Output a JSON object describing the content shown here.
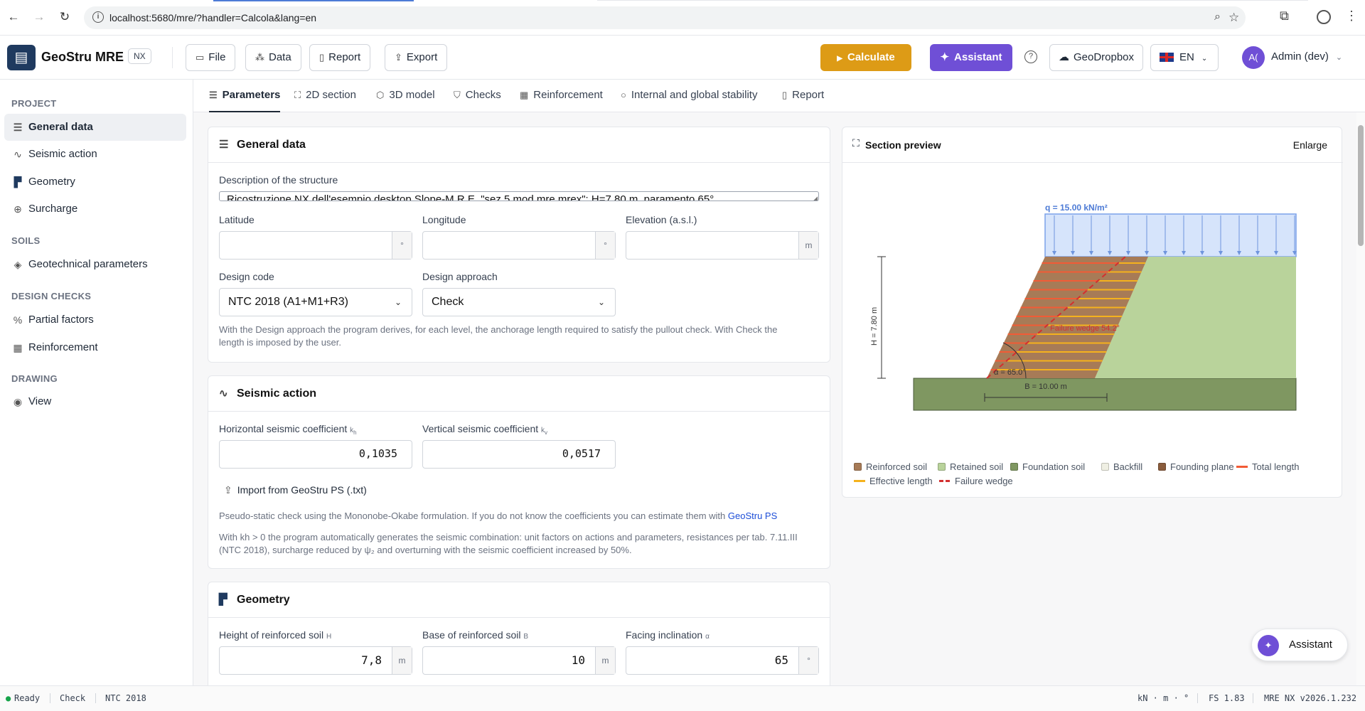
{
  "browser": {
    "url": "localhost:5680/mre/?handler=Calcola&lang=en"
  },
  "app": {
    "name": "GeoStru MRE",
    "badge": "NX",
    "menu": [
      "File",
      "Data",
      "Report",
      "Export"
    ],
    "calculate_label": "Calculate",
    "assistant_label": "Assistant",
    "help_label": "?",
    "geodropbox_label": "GeoDropbox",
    "language": "EN",
    "user_initials": "A(",
    "user_name": "Admin (dev)"
  },
  "sidebar": {
    "sections": [
      {
        "title": "PROJECT",
        "items": [
          {
            "label": "General data",
            "icon": "sliders-icon",
            "active": true
          },
          {
            "label": "Seismic action",
            "icon": "activity-icon"
          },
          {
            "label": "Geometry",
            "icon": "ruler-icon"
          },
          {
            "label": "Surcharge",
            "icon": "download-circle-icon"
          }
        ]
      },
      {
        "title": "SOILS",
        "items": [
          {
            "label": "Geotechnical parameters",
            "icon": "layers-icon"
          }
        ]
      },
      {
        "title": "DESIGN CHECKS",
        "items": [
          {
            "label": "Partial factors",
            "icon": "percent-icon"
          },
          {
            "label": "Reinforcement",
            "icon": "grid-icon"
          }
        ]
      },
      {
        "title": "DRAWING",
        "items": [
          {
            "label": "View",
            "icon": "eye-icon"
          }
        ]
      }
    ]
  },
  "tabs": [
    {
      "label": "Parameters",
      "icon": "list-icon",
      "active": true
    },
    {
      "label": "2D section",
      "icon": "section-icon"
    },
    {
      "label": "3D model",
      "icon": "cube-icon"
    },
    {
      "label": "Checks",
      "icon": "shield-icon"
    },
    {
      "label": "Reinforcement",
      "icon": "table-icon"
    },
    {
      "label": "Internal and global stability",
      "icon": "circle-icon"
    },
    {
      "label": "Report",
      "icon": "file-icon"
    }
  ],
  "general": {
    "title": "General data",
    "description_label": "Description of the structure",
    "description_value": "Ricostruzione NX dell'esempio desktop Slope-M.R.E. \"sez 5 mod mre.mrex\": H=7.80 m, paramento 65°",
    "latitude_label": "Latitude",
    "latitude_unit": "°",
    "longitude_label": "Longitude",
    "longitude_unit": "°",
    "elevation_label": "Elevation (a.s.l.)",
    "elevation_unit": "m",
    "design_code_label": "Design code",
    "design_code_value": "NTC 2018 (A1+M1+R3)",
    "design_approach_label": "Design approach",
    "design_approach_value": "Check",
    "note_line1": "With the Design approach the program derives, for each level, the anchorage length required to satisfy the pullout check. With Check the",
    "note_line2": "length is imposed by the user."
  },
  "seismic": {
    "title": "Seismic action",
    "kh_label": "Horizontal seismic coefficient",
    "kh_sym": "k",
    "kh_sub": "h",
    "kh_value": "0,1035",
    "kv_label": "Vertical seismic coefficient",
    "kv_sym": "k",
    "kv_sub": "v",
    "kv_value": "0,0517",
    "import_label": "Import from GeoStru PS (.txt)",
    "note1_text": "Pseudo-static check using the Mononobe-Okabe formulation. If you do not know the coefficients you can estimate them with",
    "note1_link": "GeoStru PS",
    "note2_line1": "With kh > 0 the program automatically generates the seismic combination: unit factors on actions and parameters, resistances per tab. 7.11.III",
    "note2_line2": "(NTC 2018), surcharge reduced by ψ₂ and overturning with the seismic coefficient increased by 50%."
  },
  "geometry": {
    "title": "Geometry",
    "h_label": "Height of reinforced soil",
    "h_sym": "H",
    "h_value": "7,8",
    "h_unit": "m",
    "b_label": "Base of reinforced soil",
    "b_sym": "B",
    "b_value": "10",
    "b_unit": "m",
    "a_label": "Facing inclination",
    "a_sym": "α",
    "a_value": "65",
    "a_unit": "°"
  },
  "preview": {
    "title": "Section preview",
    "enlarge_label": "Enlarge",
    "surcharge_label": "q = 15.00 kN/m²",
    "height_label": "H = 7.80 m",
    "base_label": "B = 10.00 m",
    "angle_label": "α = 65.0°",
    "wedge_label": "Failure wedge 54.2°",
    "colors": {
      "reinforced": "#a77b57",
      "retained": "#b9d39b",
      "foundation": "#7f9761",
      "backfill": "#efefe3",
      "founding": "#8a5c3c",
      "total": "#f25b36",
      "effective": "#f5b21d",
      "wedge": "#d32f2f",
      "surcharge": "#d6e4fb"
    },
    "legend": [
      {
        "label": "Reinforced soil",
        "kind": "swatch",
        "color": "#a77b57"
      },
      {
        "label": "Retained soil",
        "kind": "swatch",
        "color": "#b9d39b"
      },
      {
        "label": "Foundation soil",
        "kind": "swatch",
        "color": "#7f9761"
      },
      {
        "label": "Backfill",
        "kind": "swatch",
        "color": "#efefe3"
      },
      {
        "label": "Founding plane",
        "kind": "swatch",
        "color": "#8a5c3c"
      },
      {
        "label": "Total length",
        "kind": "line",
        "color": "#f25b36"
      },
      {
        "label": "Effective length",
        "kind": "line",
        "color": "#f5b21d"
      },
      {
        "label": "Failure wedge",
        "kind": "dash",
        "color": "#d32f2f"
      }
    ]
  },
  "fab": {
    "label": "Assistant"
  },
  "status": {
    "ready": "Ready",
    "mode": "Check",
    "code": "NTC 2018",
    "units": "kN · m · °",
    "fs": "FS 1.83",
    "version": "MRE NX v2026.1.232"
  }
}
